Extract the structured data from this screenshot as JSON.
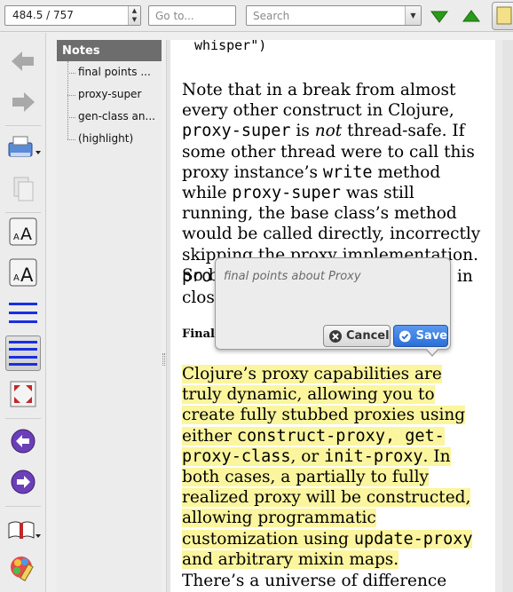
{
  "toolbar": {
    "page_position": "484.5 / 757",
    "goto_placeholder": "Go to...",
    "search_placeholder": "Search"
  },
  "notes": {
    "header": "Notes",
    "items": [
      "final points ...",
      "proxy-super",
      "gen-class an...",
      "(highlight)"
    ]
  },
  "document": {
    "top_fragment": "whisper\")",
    "p1_a": "Note that in a break from almost every other construct in Clojure, ",
    "p1_proxy_super": "proxy-super",
    "p1_b": " is ",
    "p1_not": "not",
    "p1_c": " thread-safe. If some other thread were to call this proxy instance’s ",
    "p1_write": "write",
    "p1_d": " method while ",
    "p1_proxy_super2": "proxy-super",
    "p1_e": " was still running, the base class’s method would be called directly, incorrectly skipping the proxy implementation. So be careful using",
    "p1_f_pro": "pro",
    "p1_f_in": "in",
    "p1_g_close": "close",
    "heading_frag": "Final",
    "p2_a": "Clojure’s proxy capabilities are truly dynamic, allowing you to create fully stubbed proxies using either ",
    "p2_code1": "construct-proxy, get-proxy-class",
    "p2_b": ", or ",
    "p2_code2": "init-proxy",
    "p2_c": ". In both cases, a partially to fully realized proxy will be constructed, allowing programmatic customization using ",
    "p2_code3": "update-proxy",
    "p2_d": " and arbitrary mixin maps.",
    "p3": "There’s a universe of difference between"
  },
  "popup": {
    "placeholder": "final points about Proxy",
    "cancel_label": "Cancel",
    "save_label": "Save"
  },
  "colors": {
    "highlight": "#fbf59e",
    "save_button": "#2a6fd8",
    "nav_green": "#2a9a1a",
    "nav_purple": "#6a3fb8"
  }
}
